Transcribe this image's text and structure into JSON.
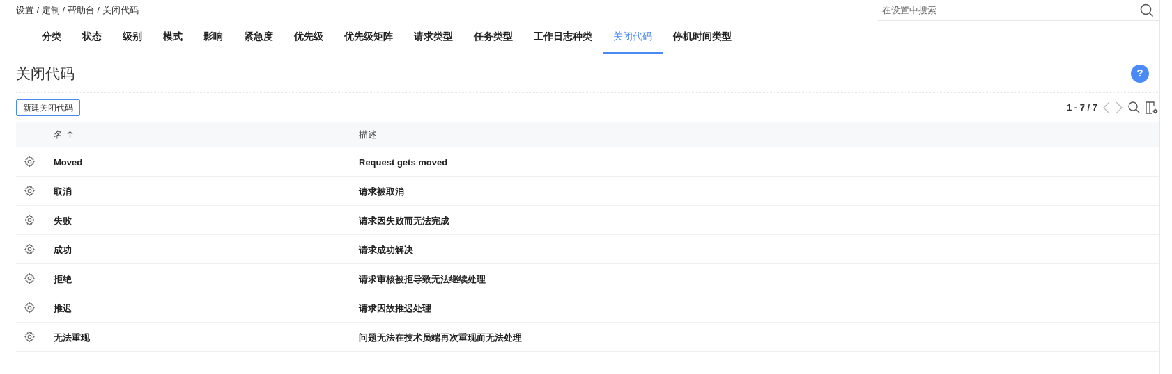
{
  "breadcrumb": "设置 / 定制 / 帮助台 / 关闭代码",
  "search": {
    "placeholder": "在设置中搜索"
  },
  "tabs": [
    {
      "label": "分类",
      "selected": false
    },
    {
      "label": "状态",
      "selected": false
    },
    {
      "label": "级别",
      "selected": false
    },
    {
      "label": "模式",
      "selected": false
    },
    {
      "label": "影响",
      "selected": false
    },
    {
      "label": "紧急度",
      "selected": false
    },
    {
      "label": "优先级",
      "selected": false
    },
    {
      "label": "优先级矩阵",
      "selected": false
    },
    {
      "label": "请求类型",
      "selected": false
    },
    {
      "label": "任务类型",
      "selected": false
    },
    {
      "label": "工作日志种类",
      "selected": false
    },
    {
      "label": "关闭代码",
      "selected": true
    },
    {
      "label": "停机时间类型",
      "selected": false
    }
  ],
  "page_title": "关闭代码",
  "help_button": "?",
  "new_button": "新建关闭代码",
  "pager": "1 - 7 / 7",
  "table": {
    "columns": [
      {
        "label": "名",
        "sorted": true
      },
      {
        "label": "描述",
        "sorted": false
      }
    ],
    "rows": [
      {
        "name": "Moved",
        "description": "Request gets moved"
      },
      {
        "name": "取消",
        "description": "请求被取消"
      },
      {
        "name": "失败",
        "description": "请求因失败而无法完成"
      },
      {
        "name": "成功",
        "description": "请求成功解决"
      },
      {
        "name": "拒绝",
        "description": "请求审核被拒导致无法继续处理"
      },
      {
        "name": "推迟",
        "description": "请求因故推迟处理"
      },
      {
        "name": "无法重现",
        "description": "问题无法在技术员端再次重现而无法处理"
      }
    ]
  }
}
